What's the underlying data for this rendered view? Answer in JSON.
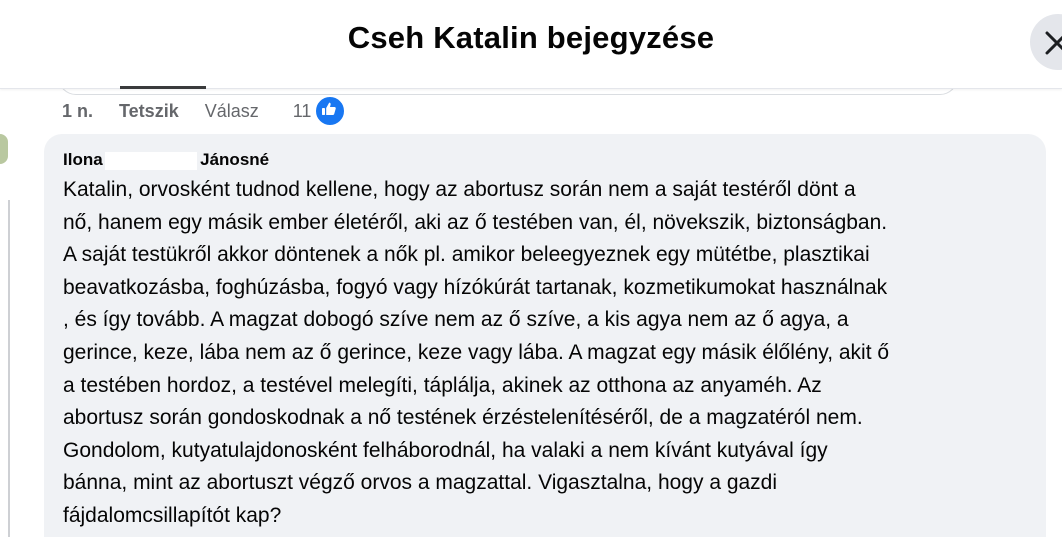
{
  "header": {
    "title": "Cseh Katalin bejegyzése",
    "close_icon": "close-icon"
  },
  "actions": {
    "time": "1 n.",
    "like_label": "Tetszik",
    "reply_label": "Válasz",
    "reaction_count": "11",
    "reaction_icon": "thumbs-up-icon",
    "accent_color": "#1877f2"
  },
  "comment": {
    "author_first": "Ilona",
    "author_last": "Jánosné",
    "lines": [
      "Katalin, orvosként tudnod kellene, hogy az abortusz során nem a saját testéről dönt a",
      "nő, hanem egy másik ember életéről, aki az ő testében van, él, növekszik, biztonságban.",
      "A saját testükről akkor döntenek a nők pl. amikor beleegyeznek egy mütétbe, plasztikai",
      "beavatkozásba, foghúzásba, fogyó vagy hízókúrát tartanak, kozmetikumokat használnak",
      ", és így tovább. A magzat dobogó szíve nem az ő szíve, a kis agya nem az ő agya, a",
      "gerince, keze, lába nem az ő gerince, keze vagy lába. A magzat egy másik élőlény, akit ő",
      "a testében hordoz, a testével melegíti, táplálja, akinek az otthona az anyaméh. Az",
      "abortusz során gondoskodnak a nő testének érzéstelenítéséről, de a magzatéról nem.",
      "Gondolom, kutyatulajdonosként felháborodnál, ha valaki a nem kívánt kutyával így",
      "bánna, mint az abortuszt végző orvos a magzattal. Vigasztalna, hogy a gazdi",
      "fájdalomcsillapítót kap?"
    ]
  }
}
